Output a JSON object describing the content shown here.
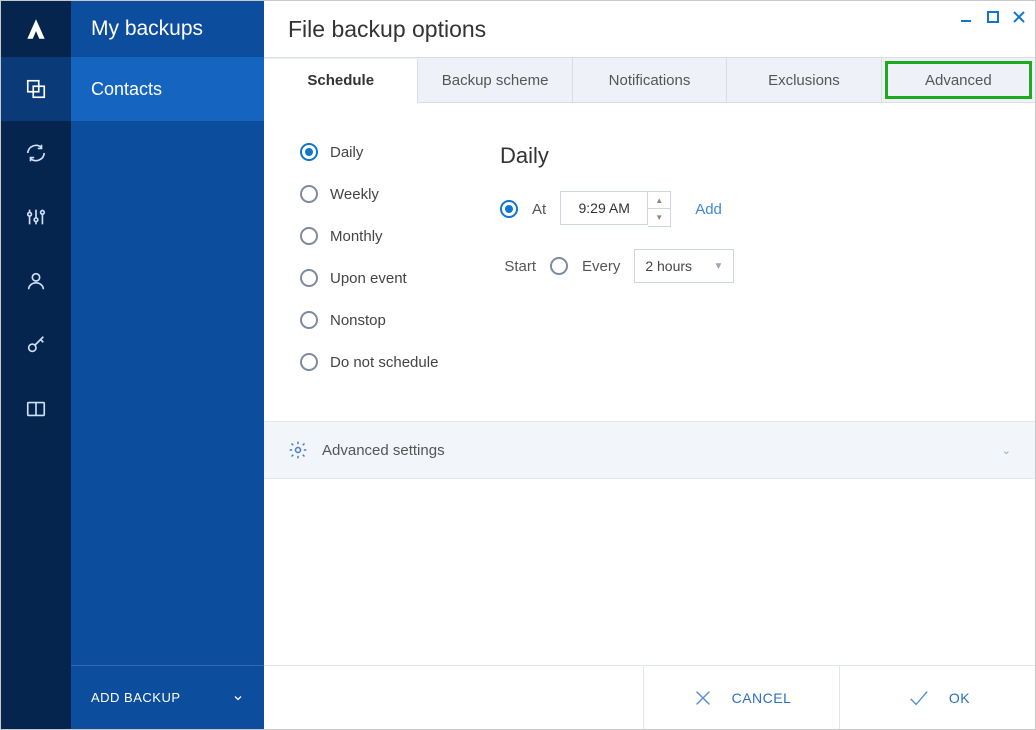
{
  "side": {
    "title": "My backups",
    "selected_item": "Contacts",
    "footer_label": "ADD BACKUP"
  },
  "window": {
    "title": "File backup options"
  },
  "tabs": {
    "schedule": "Schedule",
    "backup_scheme": "Backup scheme",
    "notifications": "Notifications",
    "exclusions": "Exclusions",
    "advanced": "Advanced",
    "active": "schedule",
    "highlighted": "advanced"
  },
  "schedule": {
    "options": {
      "daily": "Daily",
      "weekly": "Weekly",
      "monthly": "Monthly",
      "upon_event": "Upon event",
      "nonstop": "Nonstop",
      "do_not_schedule": "Do not schedule"
    },
    "selected": "daily",
    "panel_title": "Daily",
    "at_label": "At",
    "time_value": "9:29 AM",
    "add_link": "Add",
    "start_label": "Start",
    "every_label": "Every",
    "interval_value": "2 hours",
    "time_mode_selected": "at"
  },
  "advanced_settings": {
    "label": "Advanced settings"
  },
  "footer": {
    "cancel": "CANCEL",
    "ok": "OK"
  }
}
